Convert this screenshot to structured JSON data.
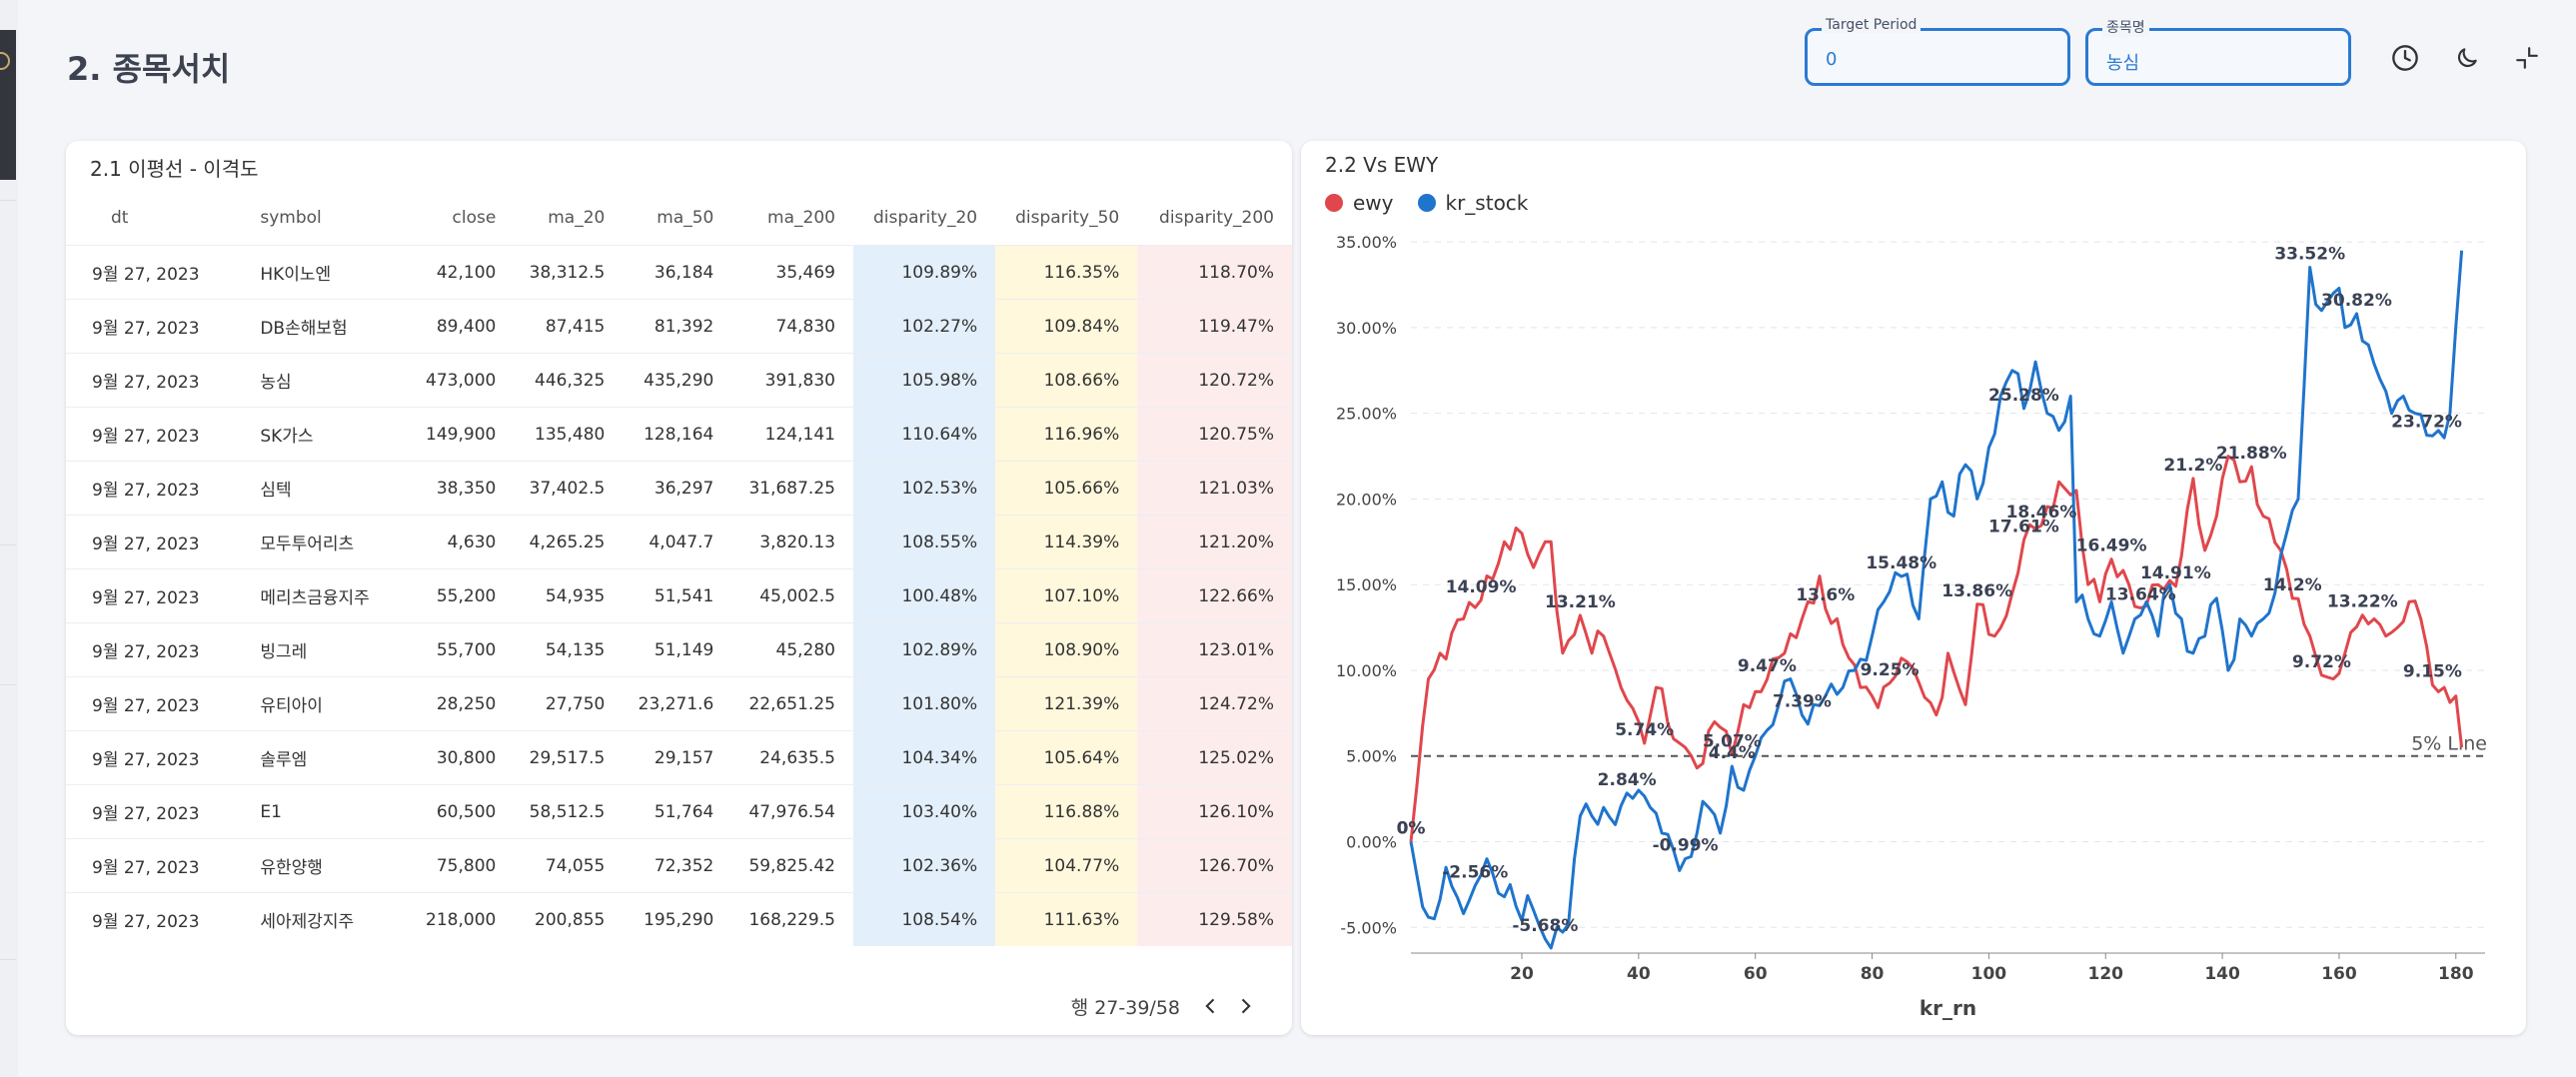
{
  "page": {
    "title": "2. 종목서치"
  },
  "filters": {
    "target_period": {
      "label": "Target Period",
      "value": "0"
    },
    "stock_name": {
      "label": "종목명",
      "value": "농심"
    }
  },
  "icons": {
    "history": "clock-icon",
    "theme": "moon-icon",
    "collapse": "collapse-icon"
  },
  "table_card": {
    "title": "2.1 이평선 - 이격도",
    "columns": [
      "dt",
      "symbol",
      "close",
      "ma_20",
      "ma_50",
      "ma_200",
      "disparity_20",
      "disparity_50",
      "disparity_200"
    ],
    "rows": [
      [
        "9월 27, 2023",
        "HK이노엔",
        "42,100",
        "38,312.5",
        "36,184",
        "35,469",
        "109.89%",
        "116.35%",
        "118.70%"
      ],
      [
        "9월 27, 2023",
        "DB손해보험",
        "89,400",
        "87,415",
        "81,392",
        "74,830",
        "102.27%",
        "109.84%",
        "119.47%"
      ],
      [
        "9월 27, 2023",
        "농심",
        "473,000",
        "446,325",
        "435,290",
        "391,830",
        "105.98%",
        "108.66%",
        "120.72%"
      ],
      [
        "9월 27, 2023",
        "SK가스",
        "149,900",
        "135,480",
        "128,164",
        "124,141",
        "110.64%",
        "116.96%",
        "120.75%"
      ],
      [
        "9월 27, 2023",
        "심텍",
        "38,350",
        "37,402.5",
        "36,297",
        "31,687.25",
        "102.53%",
        "105.66%",
        "121.03%"
      ],
      [
        "9월 27, 2023",
        "모두투어리츠",
        "4,630",
        "4,265.25",
        "4,047.7",
        "3,820.13",
        "108.55%",
        "114.39%",
        "121.20%"
      ],
      [
        "9월 27, 2023",
        "메리츠금융지주",
        "55,200",
        "54,935",
        "51,541",
        "45,002.5",
        "100.48%",
        "107.10%",
        "122.66%"
      ],
      [
        "9월 27, 2023",
        "빙그레",
        "55,700",
        "54,135",
        "51,149",
        "45,280",
        "102.89%",
        "108.90%",
        "123.01%"
      ],
      [
        "9월 27, 2023",
        "유티아이",
        "28,250",
        "27,750",
        "23,271.6",
        "22,651.25",
        "101.80%",
        "121.39%",
        "124.72%"
      ],
      [
        "9월 27, 2023",
        "솔루엠",
        "30,800",
        "29,517.5",
        "29,157",
        "24,635.5",
        "104.34%",
        "105.64%",
        "125.02%"
      ],
      [
        "9월 27, 2023",
        "E1",
        "60,500",
        "58,512.5",
        "51,764",
        "47,976.54",
        "103.40%",
        "116.88%",
        "126.10%"
      ],
      [
        "9월 27, 2023",
        "유한양행",
        "75,800",
        "74,055",
        "72,352",
        "59,825.42",
        "102.36%",
        "104.77%",
        "126.70%"
      ],
      [
        "9월 27, 2023",
        "세아제강지주",
        "218,000",
        "200,855",
        "195,290",
        "168,229.5",
        "108.54%",
        "111.63%",
        "129.58%"
      ]
    ],
    "pager_text": "행 27-39/58"
  },
  "chart_card": {
    "title": "2.2 Vs EWY"
  },
  "colors": {
    "ewy": "#e0474c",
    "kr_stock": "#1f74cc",
    "accent": "#2b7ad3",
    "d20": "#e3effa",
    "d50": "#fff8dc",
    "d200": "#fdecec"
  },
  "chart_data": {
    "type": "line",
    "xlabel": "kr_rn",
    "ylabel": "",
    "xlim": [
      1,
      185
    ],
    "ylim": [
      -6.5,
      36
    ],
    "x_ticks": [
      20,
      40,
      60,
      80,
      100,
      120,
      140,
      160,
      180
    ],
    "y_ticks": [
      -5,
      0,
      5,
      10,
      15,
      20,
      25,
      30,
      35
    ],
    "y_tick_labels": [
      "-5.00%",
      "0.00%",
      "5.00%",
      "10.00%",
      "15.00%",
      "20.00%",
      "25.00%",
      "30.00%",
      "35.00%"
    ],
    "reference_line": {
      "y": 5,
      "label": "5% Line"
    },
    "grid": true,
    "legend_position": "top-left",
    "series": [
      {
        "name": "ewy",
        "key_points": [
          [
            1,
            0
          ],
          [
            4,
            9.5
          ],
          [
            6,
            11
          ],
          [
            10,
            13
          ],
          [
            13,
            14.09
          ],
          [
            17,
            17.5
          ],
          [
            20,
            18
          ],
          [
            22,
            16
          ],
          [
            24,
            17.5
          ],
          [
            25,
            17.5
          ],
          [
            27,
            11
          ],
          [
            30,
            13.21
          ],
          [
            32,
            11
          ],
          [
            34,
            12
          ],
          [
            37,
            9
          ],
          [
            40,
            7
          ],
          [
            41,
            5.74
          ],
          [
            43,
            9
          ],
          [
            46,
            6
          ],
          [
            48,
            5.5
          ],
          [
            50,
            4.3
          ],
          [
            53,
            7
          ],
          [
            56,
            5.07
          ],
          [
            58,
            8
          ],
          [
            62,
            9.47
          ],
          [
            65,
            11
          ],
          [
            68,
            13
          ],
          [
            71,
            15.5
          ],
          [
            72,
            13.6
          ],
          [
            75,
            11.5
          ],
          [
            78,
            9
          ],
          [
            80,
            8.5
          ],
          [
            83,
            9.25
          ],
          [
            86,
            10.5
          ],
          [
            88,
            9.3
          ],
          [
            91,
            7.4
          ],
          [
            93,
            11
          ],
          [
            96,
            8
          ],
          [
            98,
            13.86
          ],
          [
            101,
            12
          ],
          [
            104,
            14.5
          ],
          [
            106,
            17.61
          ],
          [
            109,
            18.46
          ],
          [
            112,
            21
          ],
          [
            115,
            20.5
          ],
          [
            117,
            15
          ],
          [
            119,
            14
          ],
          [
            121,
            16.49
          ],
          [
            124,
            15
          ],
          [
            126,
            13.64
          ],
          [
            129,
            15
          ],
          [
            132,
            14.91
          ],
          [
            135,
            21.2
          ],
          [
            137,
            17
          ],
          [
            139,
            19
          ],
          [
            141,
            22.5
          ],
          [
            143,
            21
          ],
          [
            145,
            21.88
          ],
          [
            147,
            19
          ],
          [
            150,
            17
          ],
          [
            152,
            14.2
          ],
          [
            155,
            12
          ],
          [
            157,
            9.72
          ],
          [
            159,
            9.5
          ],
          [
            161,
            11
          ],
          [
            164,
            13.22
          ],
          [
            166,
            13
          ],
          [
            168,
            12
          ],
          [
            170,
            12.5
          ],
          [
            172,
            14
          ],
          [
            174,
            13
          ],
          [
            176,
            9.15
          ],
          [
            178,
            9
          ],
          [
            180,
            8.5
          ],
          [
            181,
            5.5
          ]
        ]
      },
      {
        "name": "kr_stock",
        "key_points": [
          [
            1,
            0
          ],
          [
            3,
            -3.8
          ],
          [
            5,
            -4.5
          ],
          [
            7,
            -1.5
          ],
          [
            10,
            -4.2
          ],
          [
            12,
            -2.56
          ],
          [
            14,
            -1
          ],
          [
            16,
            -3
          ],
          [
            18,
            -2.5
          ],
          [
            20,
            -4.6
          ],
          [
            22,
            -4
          ],
          [
            24,
            -5.68
          ],
          [
            26,
            -5
          ],
          [
            28,
            -4.8
          ],
          [
            30,
            1.5
          ],
          [
            32,
            1.5
          ],
          [
            34,
            2
          ],
          [
            36,
            1
          ],
          [
            38,
            2.84
          ],
          [
            40,
            3
          ],
          [
            42,
            2
          ],
          [
            44,
            0.5
          ],
          [
            46,
            -0.5
          ],
          [
            48,
            -0.99
          ],
          [
            50,
            0.5
          ],
          [
            52,
            2
          ],
          [
            54,
            0.5
          ],
          [
            56,
            4.4
          ],
          [
            58,
            3
          ],
          [
            60,
            5
          ],
          [
            62,
            6.5
          ],
          [
            64,
            8
          ],
          [
            66,
            9.5
          ],
          [
            68,
            7.39
          ],
          [
            70,
            8
          ],
          [
            72,
            8.5
          ],
          [
            75,
            9
          ],
          [
            77,
            10
          ],
          [
            80,
            12
          ],
          [
            82,
            14
          ],
          [
            85,
            15.48
          ],
          [
            88,
            13
          ],
          [
            90,
            20
          ],
          [
            92,
            21
          ],
          [
            94,
            19
          ],
          [
            96,
            22
          ],
          [
            98,
            20
          ],
          [
            100,
            23
          ],
          [
            102,
            26
          ],
          [
            104,
            27.5
          ],
          [
            106,
            25.28
          ],
          [
            108,
            28
          ],
          [
            110,
            25
          ],
          [
            112,
            24
          ],
          [
            114,
            26
          ],
          [
            115,
            14
          ],
          [
            117,
            13
          ],
          [
            119,
            12
          ],
          [
            121,
            14
          ],
          [
            123,
            11
          ],
          [
            125,
            13
          ],
          [
            127,
            14
          ],
          [
            129,
            12
          ],
          [
            131,
            15
          ],
          [
            133,
            13
          ],
          [
            135,
            11
          ],
          [
            137,
            12
          ],
          [
            139,
            14.2
          ],
          [
            141,
            10
          ],
          [
            143,
            13
          ],
          [
            145,
            12
          ],
          [
            147,
            13
          ],
          [
            149,
            14.5
          ],
          [
            151,
            18
          ],
          [
            153,
            20
          ],
          [
            155,
            33.52
          ],
          [
            157,
            31
          ],
          [
            159,
            32
          ],
          [
            161,
            30
          ],
          [
            163,
            30.82
          ],
          [
            165,
            29
          ],
          [
            167,
            27
          ],
          [
            169,
            25
          ],
          [
            171,
            26
          ],
          [
            173,
            25
          ],
          [
            175,
            23.72
          ],
          [
            177,
            24
          ],
          [
            179,
            25
          ],
          [
            181,
            34.5
          ]
        ]
      }
    ],
    "annotations": [
      {
        "series": "ewy",
        "x": 13,
        "y": 14.09,
        "text": "14.09%"
      },
      {
        "series": "ewy",
        "x": 30,
        "y": 13.21,
        "text": "13.21%"
      },
      {
        "series": "ewy",
        "x": 41,
        "y": 5.74,
        "text": "5.74%"
      },
      {
        "series": "ewy",
        "x": 56,
        "y": 5.07,
        "text": "5.07%"
      },
      {
        "series": "ewy",
        "x": 62,
        "y": 9.47,
        "text": "9.47%"
      },
      {
        "series": "ewy",
        "x": 72,
        "y": 13.6,
        "text": "13.6%"
      },
      {
        "series": "ewy",
        "x": 83,
        "y": 9.25,
        "text": "9.25%"
      },
      {
        "series": "ewy",
        "x": 98,
        "y": 13.86,
        "text": "13.86%"
      },
      {
        "series": "ewy",
        "x": 106,
        "y": 17.61,
        "text": "17.61%"
      },
      {
        "series": "ewy",
        "x": 109,
        "y": 18.46,
        "text": "18.46%"
      },
      {
        "series": "ewy",
        "x": 121,
        "y": 16.49,
        "text": "16.49%"
      },
      {
        "series": "ewy",
        "x": 126,
        "y": 13.64,
        "text": "13.64%"
      },
      {
        "series": "ewy",
        "x": 132,
        "y": 14.91,
        "text": "14.91%"
      },
      {
        "series": "ewy",
        "x": 135,
        "y": 21.2,
        "text": "21.2%"
      },
      {
        "series": "ewy",
        "x": 145,
        "y": 21.88,
        "text": "21.88%"
      },
      {
        "series": "ewy",
        "x": 152,
        "y": 14.2,
        "text": "14.2%"
      },
      {
        "series": "ewy",
        "x": 157,
        "y": 9.72,
        "text": "9.72%"
      },
      {
        "series": "ewy",
        "x": 164,
        "y": 13.22,
        "text": "13.22%"
      },
      {
        "series": "ewy",
        "x": 176,
        "y": 9.15,
        "text": "9.15%"
      },
      {
        "series": "ewy",
        "x": 1,
        "y": 0,
        "text": "0%"
      },
      {
        "series": "kr_stock",
        "x": 1,
        "y": 0,
        "text": "0%"
      },
      {
        "series": "kr_stock",
        "x": 12,
        "y": -2.56,
        "text": "-2.56%"
      },
      {
        "series": "kr_stock",
        "x": 24,
        "y": -5.68,
        "text": "-5.68%"
      },
      {
        "series": "kr_stock",
        "x": 38,
        "y": 2.84,
        "text": "2.84%"
      },
      {
        "series": "kr_stock",
        "x": 48,
        "y": -0.99,
        "text": "-0.99%"
      },
      {
        "series": "kr_stock",
        "x": 56,
        "y": 4.4,
        "text": "4.4%"
      },
      {
        "series": "kr_stock",
        "x": 68,
        "y": 7.39,
        "text": "7.39%"
      },
      {
        "series": "kr_stock",
        "x": 85,
        "y": 15.48,
        "text": "15.48%"
      },
      {
        "series": "kr_stock",
        "x": 106,
        "y": 25.28,
        "text": "25.28%"
      },
      {
        "series": "kr_stock",
        "x": 155,
        "y": 33.52,
        "text": "33.52%"
      },
      {
        "series": "kr_stock",
        "x": 163,
        "y": 30.82,
        "text": "30.82%"
      },
      {
        "series": "kr_stock",
        "x": 175,
        "y": 23.72,
        "text": "23.72%"
      }
    ]
  }
}
